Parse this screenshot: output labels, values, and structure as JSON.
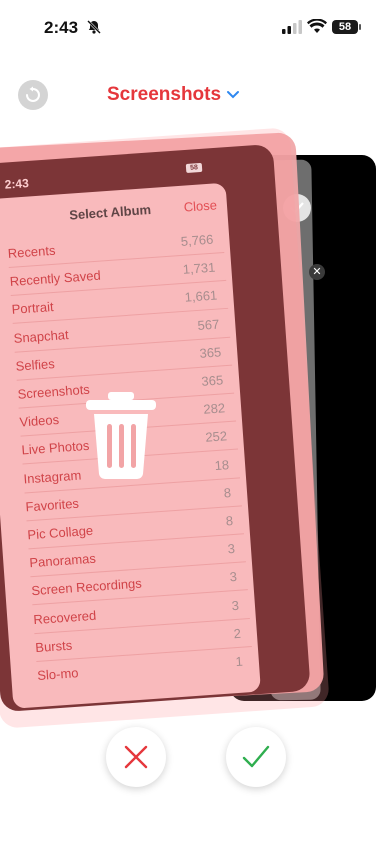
{
  "status": {
    "time": "2:43",
    "battery": "58"
  },
  "header": {
    "album_title": "Screenshots"
  },
  "preview": {
    "inner_time": "2:43",
    "inner_battery": "58",
    "sheet_title": "Select Album",
    "sheet_close": "Close",
    "albums": [
      {
        "name": "Recents",
        "count": "5,766"
      },
      {
        "name": "Recently Saved",
        "count": "1,731"
      },
      {
        "name": "Portrait",
        "count": "1,661"
      },
      {
        "name": "Snapchat",
        "count": "567"
      },
      {
        "name": "Selfies",
        "count": "365"
      },
      {
        "name": "Screenshots",
        "count": "365"
      },
      {
        "name": "Videos",
        "count": "282"
      },
      {
        "name": "Live Photos",
        "count": "252"
      },
      {
        "name": "Instagram",
        "count": "18"
      },
      {
        "name": "Favorites",
        "count": "8"
      },
      {
        "name": "Pic Collage",
        "count": "8"
      },
      {
        "name": "Panoramas",
        "count": "3"
      },
      {
        "name": "Screen Recordings",
        "count": "3"
      },
      {
        "name": "Recovered",
        "count": "3"
      },
      {
        "name": "Bursts",
        "count": "2"
      },
      {
        "name": "Slo-mo",
        "count": "1"
      }
    ]
  },
  "colors": {
    "accent": "#e5373c",
    "delete": "#e5373c",
    "keep": "#2fae4f"
  }
}
